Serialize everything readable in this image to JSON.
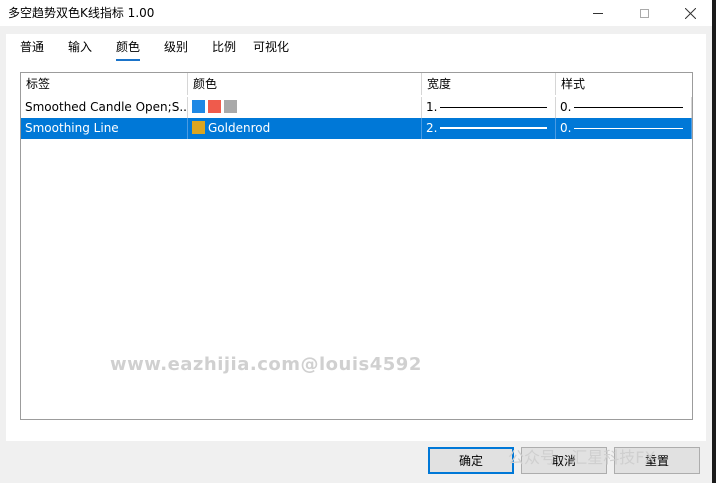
{
  "window": {
    "title": "多空趋势双色K线指标 1.00"
  },
  "tabs": [
    {
      "label": "普通",
      "active": false
    },
    {
      "label": "输入",
      "active": false
    },
    {
      "label": "颜色",
      "active": true
    },
    {
      "label": "级别",
      "active": false
    },
    {
      "label": "比例",
      "active": false
    },
    {
      "label": "可视化",
      "active": false
    }
  ],
  "table": {
    "columns": [
      "标签",
      "颜色",
      "宽度",
      "样式"
    ],
    "rows": [
      {
        "label": "Smoothed Candle Open;S...",
        "colors": [
          "#1e88e5",
          "#ef5b4c",
          "#a9a9a9"
        ],
        "color_name": "",
        "width": "1.",
        "style": "0.",
        "selected": false
      },
      {
        "label": "Smoothing Line",
        "colors": [
          "#daa520"
        ],
        "color_name": "Goldenrod",
        "width": "2.",
        "style": "0.",
        "selected": true
      }
    ]
  },
  "watermark": "www.eazhijia.com@louis4592",
  "overlay_text": "公众号 · 汇星科技FX",
  "buttons": {
    "ok": "确定",
    "cancel": "取消",
    "reset": "重置"
  }
}
